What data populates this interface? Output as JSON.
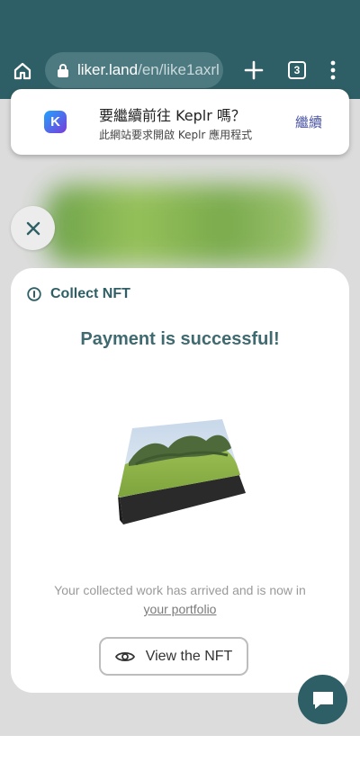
{
  "browser": {
    "url_host": "liker.land",
    "url_path": "/en/like1axrl",
    "tab_count": "3",
    "icons": {
      "home": "home-icon",
      "lock": "lock-icon",
      "new_tab": "plus-icon",
      "menu": "more-vert-icon"
    }
  },
  "app_prompt": {
    "title": "要繼續前往 Keplr 嗎？",
    "subtitle": "此網站要求開啟 Keplr 應用程式",
    "continue_label": "繼續",
    "logo_letter": "K"
  },
  "modal": {
    "header_label": "Collect NFT",
    "success_title": "Payment is successful!",
    "message_text": "Your collected work has arrived and is now in",
    "portfolio_link": "your portfolio",
    "view_button_label": "View the NFT"
  },
  "colors": {
    "header_bg": "#2f5f66",
    "accent": "#2f5f66",
    "keplr_blue": "#4a55a3"
  }
}
